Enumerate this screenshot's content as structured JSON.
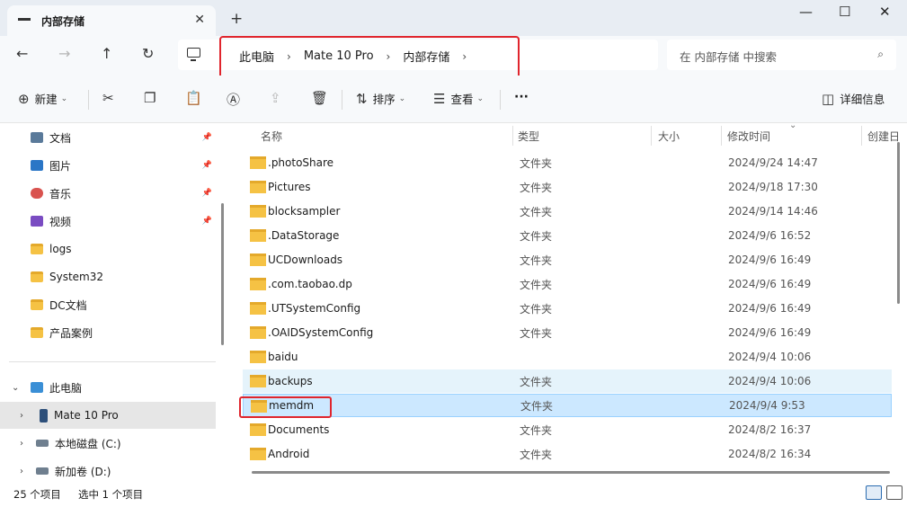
{
  "window": {
    "tab_title": "内部存储",
    "tab_close": "✕",
    "new_tab": "+",
    "minimize": "—",
    "maximize": "☐",
    "close": "✕"
  },
  "nav": {
    "back": "←",
    "forward": "→",
    "up": "↑",
    "refresh": "↻"
  },
  "breadcrumb": {
    "items": [
      "此电脑",
      "Mate 10 Pro",
      "内部存储"
    ],
    "separator": "›"
  },
  "search": {
    "placeholder": "在 内部存储 中搜索",
    "icon": "⌕"
  },
  "toolbar": {
    "new_label": "新建",
    "sort_label": "排序",
    "view_label": "查看",
    "more_label": "···",
    "details_label": "详细信息"
  },
  "sidebar": {
    "quick_access": [
      {
        "label": "文档",
        "icon": "document-icon",
        "color": "#5a7a9a",
        "pinned": true
      },
      {
        "label": "图片",
        "icon": "pictures-icon",
        "color": "#2a76c6",
        "pinned": true
      },
      {
        "label": "音乐",
        "icon": "music-icon",
        "color": "#d9534f",
        "pinned": true
      },
      {
        "label": "视频",
        "icon": "video-icon",
        "color": "#7a4cc2",
        "pinned": true
      },
      {
        "label": "logs",
        "icon": "folder-icon"
      },
      {
        "label": "System32",
        "icon": "folder-icon"
      },
      {
        "label": "DC文档",
        "icon": "folder-icon"
      },
      {
        "label": "产品案例",
        "icon": "folder-icon"
      }
    ],
    "pin_glyph": "📌",
    "this_pc": "此电脑",
    "devices": [
      {
        "label": "Mate 10 Pro",
        "icon": "phone-icon"
      },
      {
        "label": "本地磁盘 (C:)",
        "icon": "drive-icon"
      },
      {
        "label": "新加卷 (D:)",
        "icon": "drive-icon"
      }
    ]
  },
  "columns": {
    "name": "名称",
    "type": "类型",
    "size": "大小",
    "modified": "修改时间",
    "created": "创建日"
  },
  "files": [
    {
      "name": ".photoShare",
      "type": "文件夹",
      "date": "2024/9/24 14:47"
    },
    {
      "name": "Pictures",
      "type": "文件夹",
      "date": "2024/9/18 17:30"
    },
    {
      "name": "blocksampler",
      "type": "文件夹",
      "date": "2024/9/14 14:46"
    },
    {
      "name": ".DataStorage",
      "type": "文件夹",
      "date": "2024/9/6 16:52"
    },
    {
      "name": "UCDownloads",
      "type": "文件夹",
      "date": "2024/9/6 16:49"
    },
    {
      "name": ".com.taobao.dp",
      "type": "文件夹",
      "date": "2024/9/6 16:49"
    },
    {
      "name": ".UTSystemConfig",
      "type": "文件夹",
      "date": "2024/9/6 16:49"
    },
    {
      "name": ".OAIDSystemConfig",
      "type": "文件夹",
      "date": "2024/9/6 16:49"
    },
    {
      "name": "baidu",
      "type": "",
      "date": "2024/9/4 10:06"
    },
    {
      "name": "backups",
      "type": "文件夹",
      "date": "2024/9/4 10:06"
    },
    {
      "name": "memdm",
      "type": "文件夹",
      "date": "2024/9/4 9:53"
    },
    {
      "name": "Documents",
      "type": "文件夹",
      "date": "2024/8/2 16:37"
    },
    {
      "name": "Android",
      "type": "文件夹",
      "date": "2024/8/2 16:34"
    }
  ],
  "status": {
    "count": "25 个项目",
    "selected": "选中 1 个项目"
  },
  "colors": {
    "accent": "#0067c0",
    "highlight_red": "#e0252d",
    "folder_yellow": "#f5c244",
    "selected_row": "#cce8ff"
  }
}
